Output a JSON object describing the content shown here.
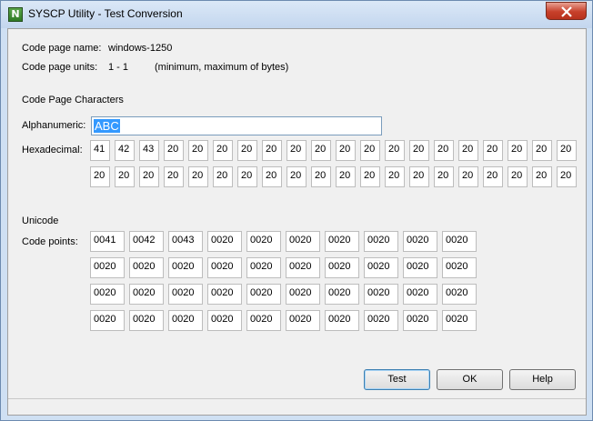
{
  "window": {
    "title": "SYSCP Utility - Test Conversion",
    "app_icon_letter": "N"
  },
  "info": {
    "code_page_name_label": "Code page name:",
    "code_page_name_value": "windows-1250",
    "code_page_units_label": "Code page units:",
    "code_page_units_value": "1 - 1",
    "code_page_units_note": "(minimum, maximum of bytes)"
  },
  "code_page_section": {
    "heading": "Code Page Characters",
    "alphanumeric_label": "Alphanumeric:",
    "alphanumeric_value": "ABC",
    "hexadecimal_label": "Hexadecimal:",
    "hex_row1": [
      "41",
      "42",
      "43",
      "20",
      "20",
      "20",
      "20",
      "20",
      "20",
      "20",
      "20",
      "20",
      "20",
      "20",
      "20",
      "20",
      "20",
      "20",
      "20",
      "20"
    ],
    "hex_row2": [
      "20",
      "20",
      "20",
      "20",
      "20",
      "20",
      "20",
      "20",
      "20",
      "20",
      "20",
      "20",
      "20",
      "20",
      "20",
      "20",
      "20",
      "20",
      "20",
      "20"
    ]
  },
  "unicode_section": {
    "heading": "Unicode",
    "code_points_label": "Code points:",
    "rows": [
      [
        "0041",
        "0042",
        "0043",
        "0020",
        "0020",
        "0020",
        "0020",
        "0020",
        "0020",
        "0020"
      ],
      [
        "0020",
        "0020",
        "0020",
        "0020",
        "0020",
        "0020",
        "0020",
        "0020",
        "0020",
        "0020"
      ],
      [
        "0020",
        "0020",
        "0020",
        "0020",
        "0020",
        "0020",
        "0020",
        "0020",
        "0020",
        "0020"
      ],
      [
        "0020",
        "0020",
        "0020",
        "0020",
        "0020",
        "0020",
        "0020",
        "0020",
        "0020",
        "0020"
      ]
    ]
  },
  "buttons": {
    "test": "Test",
    "ok": "OK",
    "help": "Help"
  },
  "colors": {
    "selection": "#3399ff",
    "close_button": "#c7402b"
  }
}
